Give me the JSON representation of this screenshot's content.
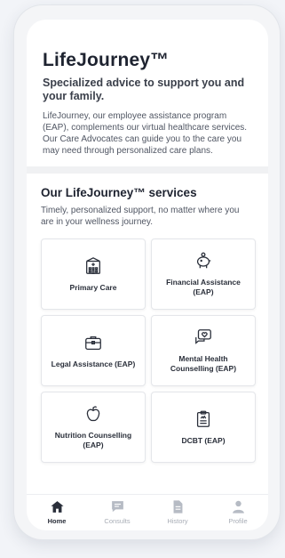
{
  "intro": {
    "title": "LifeJourney™",
    "subtitle": "Specialized advice to support you and your family.",
    "body": "LifeJourney, our employee assistance program (EAP), complements our virtual healthcare services. Our Care Advocates can guide you to the care you may need through personalized care plans."
  },
  "services": {
    "title": "Our LifeJourney™ services",
    "subtitle": "Timely, personalized support, no matter where you are in your wellness journey.",
    "tiles": [
      {
        "label": "Primary Care",
        "icon": "hospital-icon"
      },
      {
        "label": "Financial Assistance (EAP)",
        "icon": "piggy-bank-icon"
      },
      {
        "label": "Legal Assistance (EAP)",
        "icon": "briefcase-icon"
      },
      {
        "label": "Mental Health Counselling (EAP)",
        "icon": "heart-chat-icon"
      },
      {
        "label": "Nutrition Counselling (EAP)",
        "icon": "apple-icon"
      },
      {
        "label": "DCBT (EAP)",
        "icon": "clipboard-icon"
      }
    ]
  },
  "nav": {
    "items": [
      {
        "label": "Home",
        "icon": "home-icon",
        "active": true
      },
      {
        "label": "Consults",
        "icon": "chat-icon",
        "active": false
      },
      {
        "label": "History",
        "icon": "document-icon",
        "active": false
      },
      {
        "label": "Profile",
        "icon": "user-icon",
        "active": false
      }
    ]
  },
  "colors": {
    "text": "#1e2330",
    "muted": "#505663",
    "nav_inactive": "#a8adb6",
    "background": "#f0f1f3"
  }
}
